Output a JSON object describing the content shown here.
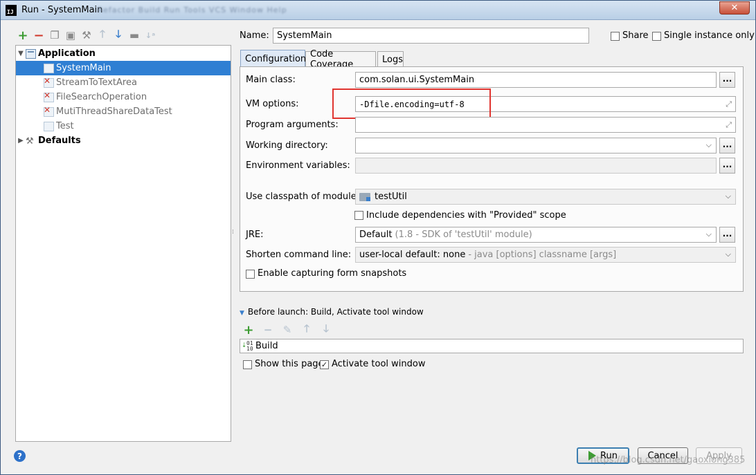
{
  "window": {
    "title": "Run - SystemMain",
    "menu_blur": "Refactor  Build  Run  Tools  VCS  Window  Help"
  },
  "toolbar": {
    "add": "+",
    "remove": "−",
    "copy": "⧉",
    "save": "💾",
    "edit_defaults": "🔧",
    "move_up": "↑",
    "move_down": "↓",
    "folder": "▬",
    "sort": "↓a"
  },
  "tree": {
    "application": "Application",
    "items": [
      "SystemMain",
      "StreamToTextArea",
      "FileSearchOperation",
      "MutiThreadShareDataTest",
      "Test"
    ],
    "defaults": "Defaults"
  },
  "header": {
    "name_label": "Name:",
    "name_value": "SystemMain",
    "share_label": "Share",
    "single_instance_label": "Single instance only"
  },
  "tabs": [
    "Configuration",
    "Code Coverage",
    "Logs"
  ],
  "form": {
    "main_class_label": "Main class:",
    "main_class_value": "com.solan.ui.SystemMain",
    "vm_options_label": "VM options:",
    "vm_options_value": "-Dfile.encoding=utf-8",
    "program_args_label": "Program arguments:",
    "program_args_value": "",
    "working_dir_label": "Working directory:",
    "working_dir_value": "",
    "env_vars_label": "Environment variables:",
    "env_vars_value": "",
    "classpath_label": "Use classpath of module:",
    "classpath_value": "testUtil",
    "include_deps_label": "Include dependencies with \"Provided\" scope",
    "jre_label": "JRE:",
    "jre_value": "Default",
    "jre_hint": "(1.8 - SDK of 'testUtil' module)",
    "shorten_label": "Shorten command line:",
    "shorten_value": "user-local default: none",
    "shorten_hint": "- java [options] classname [args]",
    "snapshots_label": "Enable capturing form snapshots",
    "dots": "...",
    "include_deps_checked": false,
    "snapshots_checked": false
  },
  "before_launch": {
    "header": "Before launch: Build, Activate tool window",
    "item": "Build",
    "show_page_label": "Show this page",
    "show_page_checked": false,
    "activate_label": "Activate tool window",
    "activate_checked": true
  },
  "buttons": {
    "run": "Run",
    "cancel": "Cancel",
    "apply": "Apply",
    "help": "?"
  },
  "watermark": "https://blog.csdn.net/gaoxiong385",
  "colors": {
    "selection": "#2f7fd3",
    "highlight": "#e0342f",
    "run_green": "#3d9c33"
  }
}
